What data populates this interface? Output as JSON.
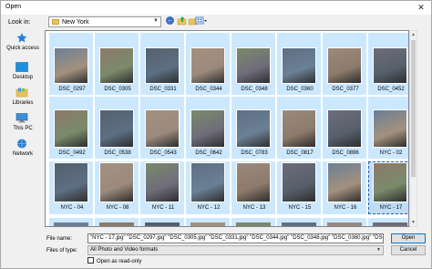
{
  "window": {
    "title": "Open",
    "close_glyph": "✕"
  },
  "toolbar": {
    "lookin_label": "Look in:",
    "lookin_value": "New York",
    "icons": [
      "back-icon",
      "up-folder-icon",
      "new-folder-icon",
      "view-menu-icon"
    ]
  },
  "places": [
    {
      "label": "Quick access",
      "icon": "star-icon"
    },
    {
      "label": "Desktop",
      "icon": "desktop-icon"
    },
    {
      "label": "Libraries",
      "icon": "libraries-icon"
    },
    {
      "label": "This PC",
      "icon": "computer-icon"
    },
    {
      "label": "Network",
      "icon": "network-icon"
    }
  ],
  "files": {
    "row1": [
      "DSC_0297",
      "DSC_0305",
      "DSC_0331",
      "DSC_0344",
      "DSC_0348",
      "DSC_0360",
      "DSC_0377",
      "DSC_0452"
    ],
    "row2": [
      "DSC_0492",
      "DSC_0538",
      "DSC_0543",
      "DSC_0642",
      "DSC_0783",
      "DSC_0817",
      "DSC_0896",
      "NYC - 02"
    ],
    "row3": [
      "NYC - 04",
      "NYC - 08",
      "NYC - 11",
      "NYC - 12",
      "NYC - 13",
      "NYC - 15",
      "NYC - 16",
      "NYC - 17"
    ]
  },
  "form": {
    "filename_label": "File name:",
    "filename_value": "\"NYC - 17.jpg\" \"DSC_0297.jpg\" \"DSC_0305.jpg\" \"DSC_0331.jpg\" \"DSC_0344.jpg\" \"DSC_0348.jpg\" \"DSC_0360.jpg\" \"DSC_0377.jpg\" \"[",
    "filetype_label": "Files of type:",
    "filetype_value": "All Photo and Video formats",
    "readonly_label": "Open as read-only"
  },
  "buttons": {
    "open": "Open",
    "cancel": "Cancel"
  }
}
